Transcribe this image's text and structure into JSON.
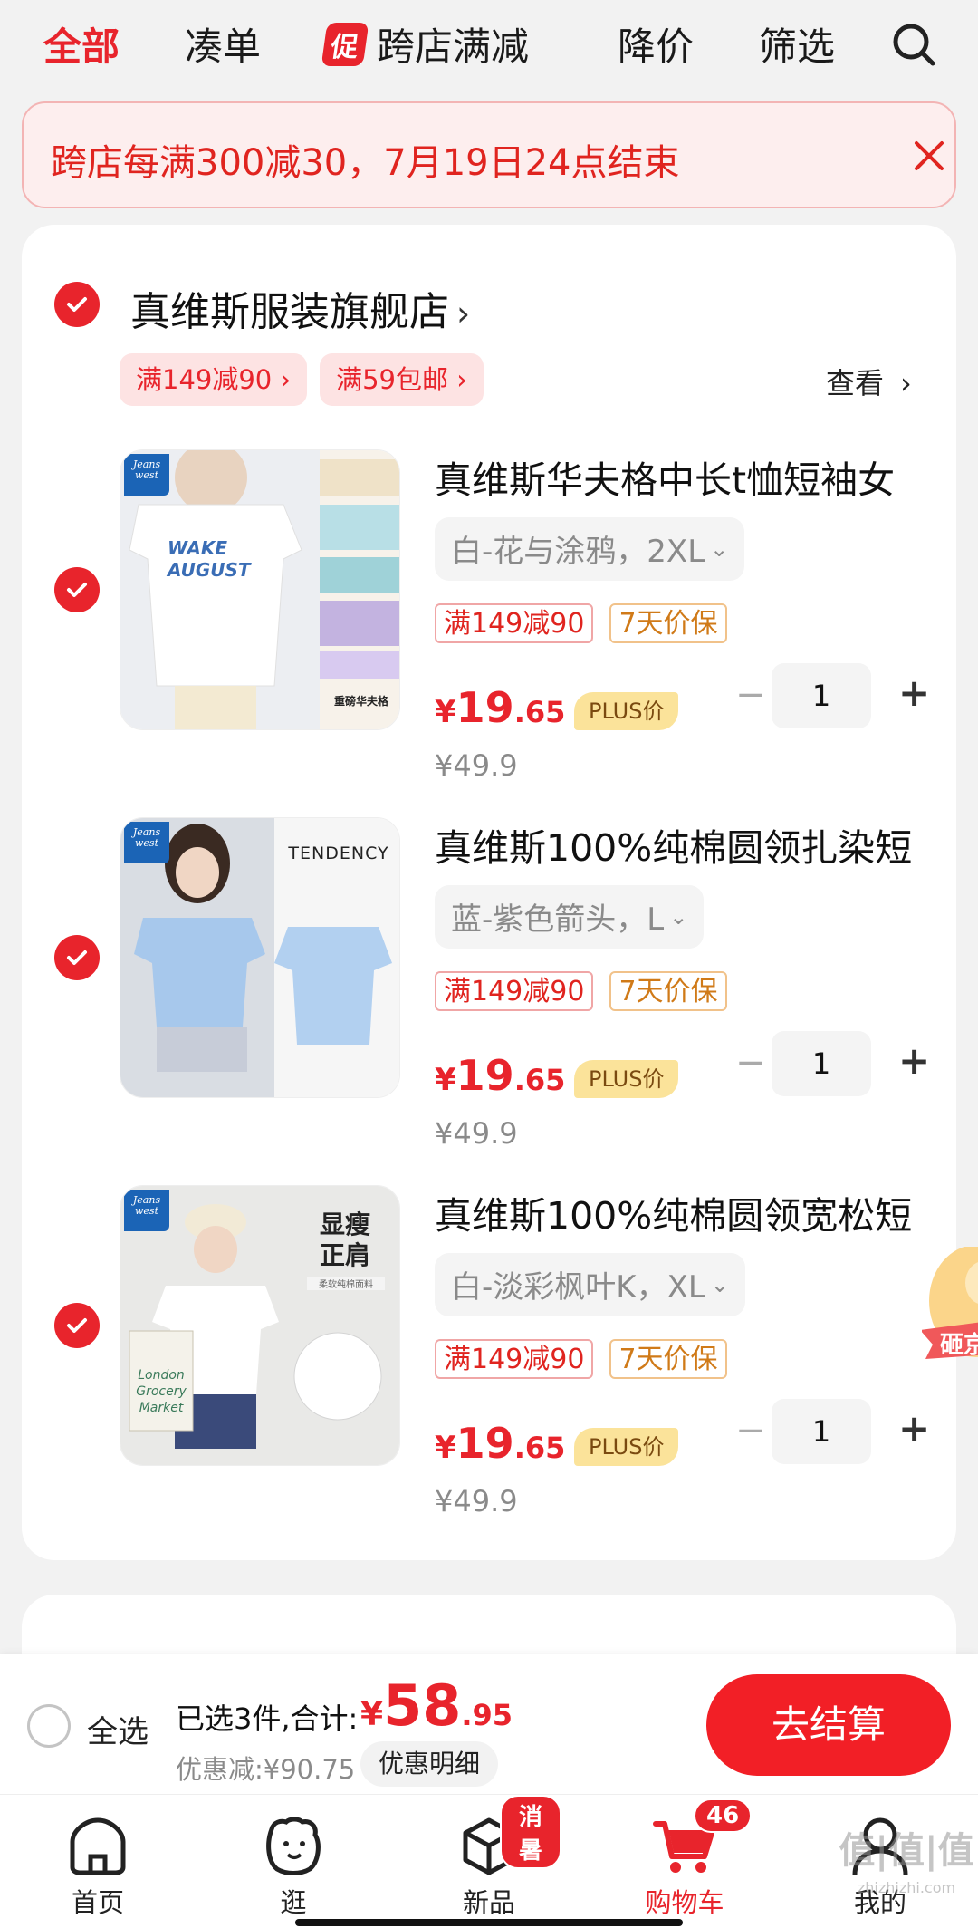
{
  "top_tabs": {
    "all": "全部",
    "bundle": "凑单",
    "promo_badge": "促",
    "cross_store": "跨店满减",
    "price_drop": "降价",
    "filter": "筛选"
  },
  "banner": {
    "text": "跨店每满300减30，7月19日24点结束"
  },
  "store": {
    "name": "真维斯服装旗舰店",
    "tags": [
      "满149减90",
      "满59包邮"
    ],
    "view_more": "查看"
  },
  "items": [
    {
      "title": "真维斯华夫格中长t恤短袖女",
      "spec": "白-花与涂鸦，2XL",
      "promo_tag": "满149减90",
      "guarantee_tag": "7天价保",
      "price_yen": "¥",
      "price_int": "19",
      "price_dec": ".65",
      "plus_label": "PLUS价",
      "orig_price": "¥49.9",
      "qty": "1",
      "thumb_text": "WAKE AUGUST",
      "thumb_side_text": "重磅华夫格"
    },
    {
      "title": "真维斯100%纯棉圆领扎染短",
      "spec": "蓝-紫色箭头，L",
      "promo_tag": "满149减90",
      "guarantee_tag": "7天价保",
      "price_yen": "¥",
      "price_int": "19",
      "price_dec": ".65",
      "plus_label": "PLUS价",
      "orig_price": "¥49.9",
      "qty": "1",
      "thumb_text": "TENDENCY"
    },
    {
      "title": "真维斯100%纯棉圆领宽松短",
      "spec": "白-淡彩枫叶K，XL",
      "promo_tag": "满149减90",
      "guarantee_tag": "7天价保",
      "price_yen": "¥",
      "price_int": "19",
      "price_dec": ".65",
      "plus_label": "PLUS价",
      "orig_price": "¥49.9",
      "qty": "1",
      "thumb_text": "显瘦 正肩",
      "thumb_sub": "柔软纯棉面料",
      "bag_text": "London Grocery Market"
    }
  ],
  "brand_logo": "Jeans west",
  "float_ball": "砸京",
  "checkout": {
    "select_all": "全选",
    "sum_label": "已选3件,合计:",
    "sum_yen": "¥",
    "sum_int": "58",
    "sum_dec": ".95",
    "discount": "优惠减:¥90.75",
    "detail_button": "优惠明细",
    "pay_button": "去结算"
  },
  "bottom_nav": {
    "home": "首页",
    "browse": "逛",
    "new": "新品",
    "new_badge": "消暑",
    "cart": "购物车",
    "cart_badge": "46",
    "mine": "我的"
  },
  "watermark": {
    "main": "值|值|值",
    "sub": "zhizhizhi.com"
  },
  "colors": {
    "accent": "#e8242c",
    "plus_badge": "#fbe39a",
    "guarantee": "#d07a18"
  }
}
